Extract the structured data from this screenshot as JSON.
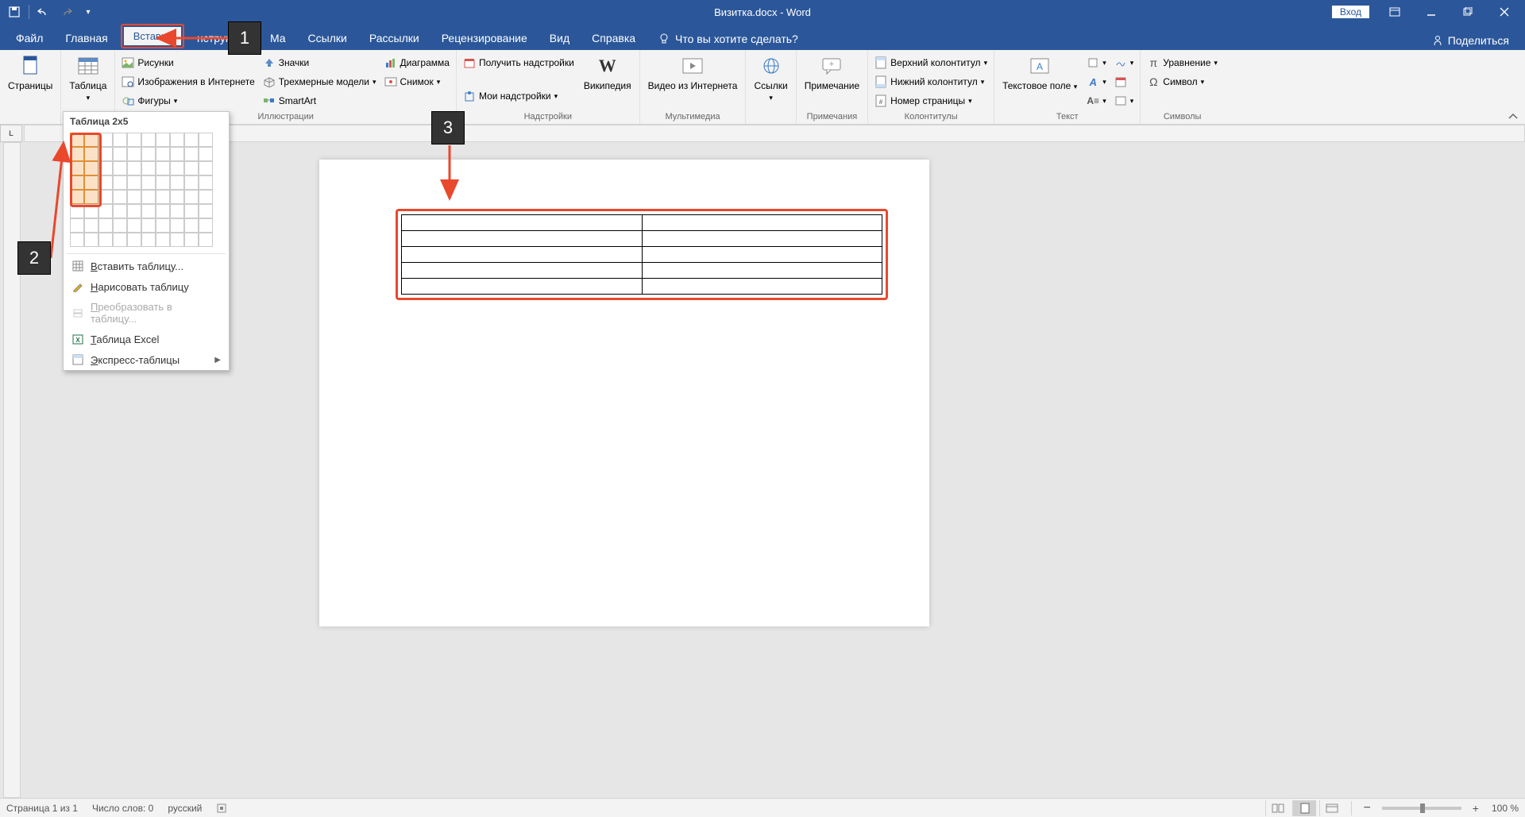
{
  "title": "Визитка.docx - Word",
  "login": "Вход",
  "tabs": {
    "file": "Файл",
    "home": "Главная",
    "insert": "Вставка",
    "design": "нструктор",
    "layout": "Ма",
    "references": "Ссылки",
    "mailings": "Рассылки",
    "review": "Рецензирование",
    "view": "Вид",
    "help": "Справка",
    "tellme": "Что вы хотите сделать?"
  },
  "share": "Поделиться",
  "ribbon": {
    "pages": {
      "label": "Страницы"
    },
    "tables": {
      "btn": "Таблица"
    },
    "illustrations": {
      "group": "Иллюстрации",
      "pictures": "Рисунки",
      "online_images": "Изображения в Интернете",
      "shapes": "Фигуры",
      "icons": "Значки",
      "models3d": "Трехмерные модели",
      "smartart": "SmartArt",
      "chart": "Диаграмма",
      "screenshot": "Снимок"
    },
    "addins": {
      "group": "Надстройки",
      "get": "Получить надстройки",
      "my": "Мои надстройки",
      "wikipedia": "Википедия"
    },
    "media": {
      "group": "Мультимедиа",
      "video": "Видео из Интернета"
    },
    "links": {
      "group": "",
      "link": "Ссылки"
    },
    "comments": {
      "group": "Примечания",
      "comment": "Примечание"
    },
    "headerfooter": {
      "group": "Колонтитулы",
      "header": "Верхний колонтитул",
      "footer": "Нижний колонтитул",
      "pagenum": "Номер страницы"
    },
    "text": {
      "group": "Текст",
      "textbox": "Текстовое поле"
    },
    "symbols": {
      "group": "Символы",
      "equation": "Уравнение",
      "symbol": "Символ"
    }
  },
  "table_dd": {
    "title": "Таблица 2x5",
    "insert": "Вставить таблицу...",
    "draw": "Нарисовать таблицу",
    "convert": "Преобразовать в таблицу...",
    "excel": "Таблица Excel",
    "quick": "Экспресс-таблицы",
    "cols": 2,
    "rows": 5
  },
  "callouts": {
    "c1": "1",
    "c2": "2",
    "c3": "3"
  },
  "status": {
    "page": "Страница 1 из 1",
    "words": "Число слов: 0",
    "lang": "русский",
    "zoom": "100 %"
  }
}
